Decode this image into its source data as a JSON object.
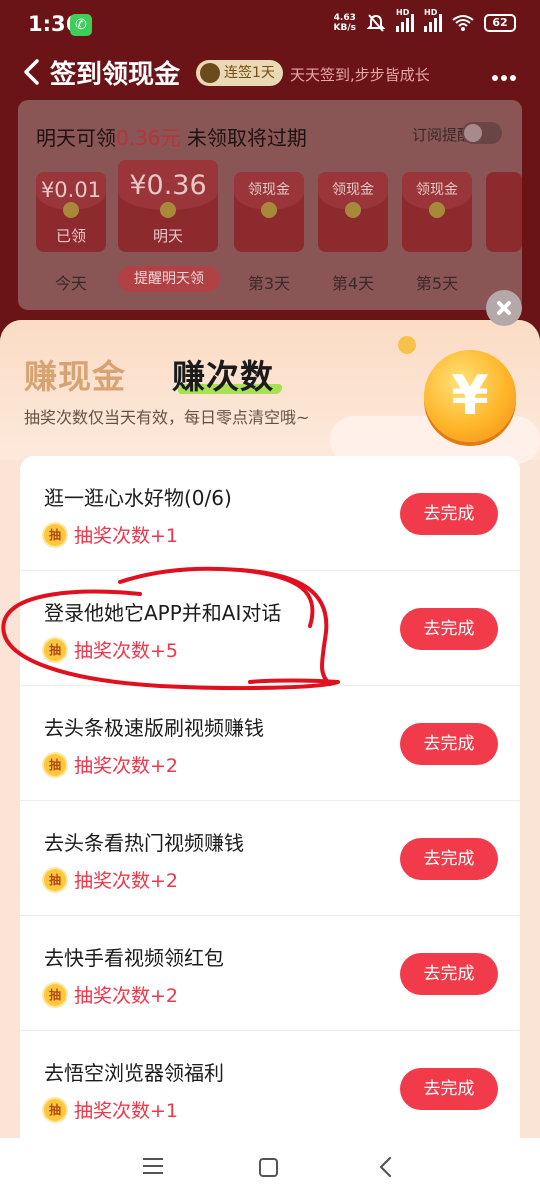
{
  "status_bar": {
    "time": "1:36",
    "net_speed": "4.63",
    "net_unit": "KB/s",
    "network_1": "HD",
    "network_2": "HD",
    "battery": "62"
  },
  "header": {
    "title": "签到领现金",
    "streak_badge": "连签1天",
    "slogan": "天天签到,步步皆成长"
  },
  "signin_card": {
    "tomorrow_prefix": "明天可领",
    "tomorrow_amount": "0.36元",
    "tomorrow_suffix": " 未领取将过期",
    "remind_label": "订阅提醒",
    "remind_button": "提醒明天领",
    "days": [
      {
        "amount": "¥0.01",
        "status": "已领",
        "label": "今天"
      },
      {
        "amount": "¥0.36",
        "status": "明天",
        "label": ""
      },
      {
        "amount": "领现金",
        "status": "",
        "label": "第3天"
      },
      {
        "amount": "领现金",
        "status": "",
        "label": "第4天"
      },
      {
        "amount": "领现金",
        "status": "",
        "label": "第5天"
      }
    ]
  },
  "sheet": {
    "tab_earn_cash": "赚现金",
    "tab_earn_times": "赚次数",
    "subtitle": "抽奖次数仅当天有效，每日零点清空哦~",
    "coin_symbol": "¥"
  },
  "reward_icon_text": "抽",
  "tasks": [
    {
      "title": "逛一逛心水好物(0/6)",
      "reward": "抽奖次数+1",
      "button": "去完成"
    },
    {
      "title": "登录他她它APP并和AI对话",
      "reward": "抽奖次数+5",
      "button": "去完成"
    },
    {
      "title": "去头条极速版刷视频赚钱",
      "reward": "抽奖次数+2",
      "button": "去完成"
    },
    {
      "title": "去头条看热门视频赚钱",
      "reward": "抽奖次数+2",
      "button": "去完成"
    },
    {
      "title": "去快手看视频领红包",
      "reward": "抽奖次数+2",
      "button": "去完成"
    },
    {
      "title": "去悟空浏览器领福利",
      "reward": "抽奖次数+1",
      "button": "去完成"
    }
  ],
  "colors": {
    "accent_red": "#f13a4a",
    "reward_red": "#f0364a",
    "highlight_green": "#a7e053",
    "scribble": "#e0101e"
  }
}
